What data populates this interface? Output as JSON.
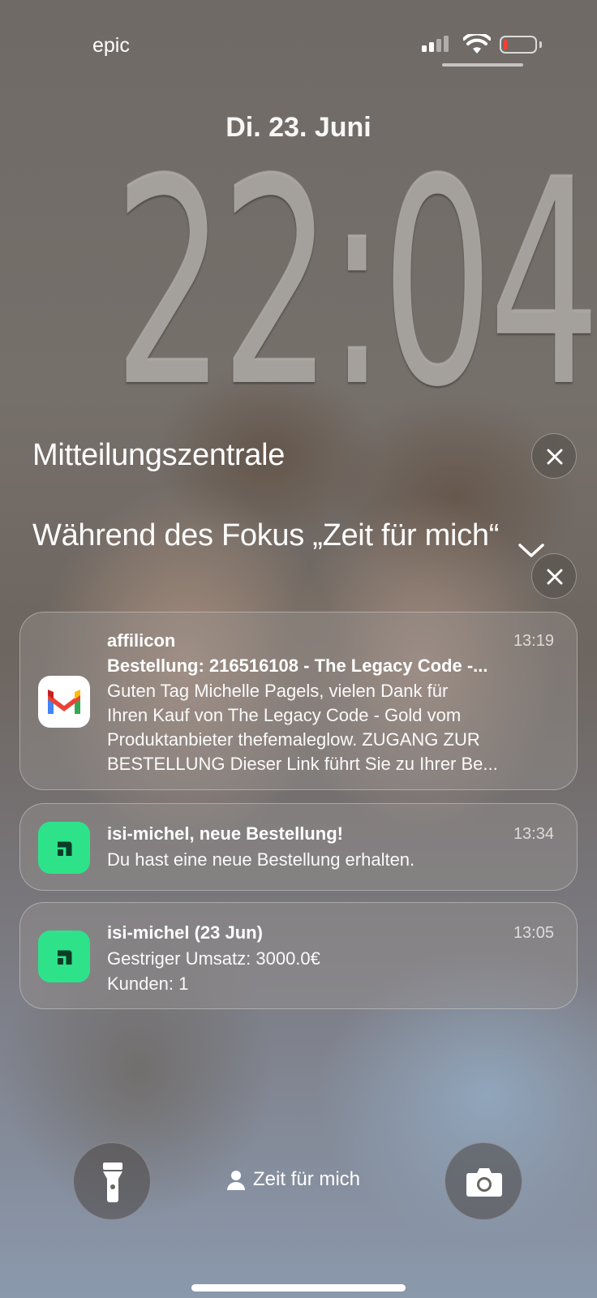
{
  "status_bar": {
    "carrier": "epic",
    "icons": [
      "cellular-signal-icon",
      "wifi-icon",
      "battery-icon"
    ],
    "battery_level": 0.1,
    "battery_color": "#ff3b30"
  },
  "lock_screen": {
    "date": "Di. 23. Juni",
    "time": "22:04"
  },
  "notification_center": {
    "title": "Mitteilungszentrale",
    "focus_section_title": "Während des Fokus „Zeit für mich“",
    "notifications": [
      {
        "app": "affilicon",
        "icon": "gmail-icon",
        "time": "13:19",
        "subject": "Bestellung: 216516108 - The Legacy Code -...",
        "body_lines": [
          "Guten Tag Michelle Pagels, vielen Dank für",
          "Ihren Kauf von The Legacy Code - Gold vom",
          "Produktanbieter thefemaleglow. ZUGANG ZUR",
          "BESTELLUNG Dieser Link führt Sie zu Ihrer Be..."
        ]
      },
      {
        "app": "isi-michel, neue Bestellung!",
        "icon": "shop-app-icon",
        "time": "13:34",
        "body_lines": [
          "Du hast eine neue Bestellung erhalten."
        ]
      },
      {
        "app": "isi-michel (23 Jun)",
        "icon": "shop-app-icon",
        "time": "13:05",
        "body_lines": [
          "Gestriger Umsatz: 3000.0€",
          "Kunden: 1"
        ]
      }
    ]
  },
  "bottom_bar": {
    "flashlight_icon": "flashlight-icon",
    "focus_label": "Zeit für mich",
    "camera_icon": "camera-icon"
  },
  "colors": {
    "accent_green": "#2ee28a",
    "gmail_red": "#ea4335",
    "gmail_blue": "#4285f4",
    "gmail_green": "#34a853",
    "gmail_yellow": "#fbbc04"
  }
}
